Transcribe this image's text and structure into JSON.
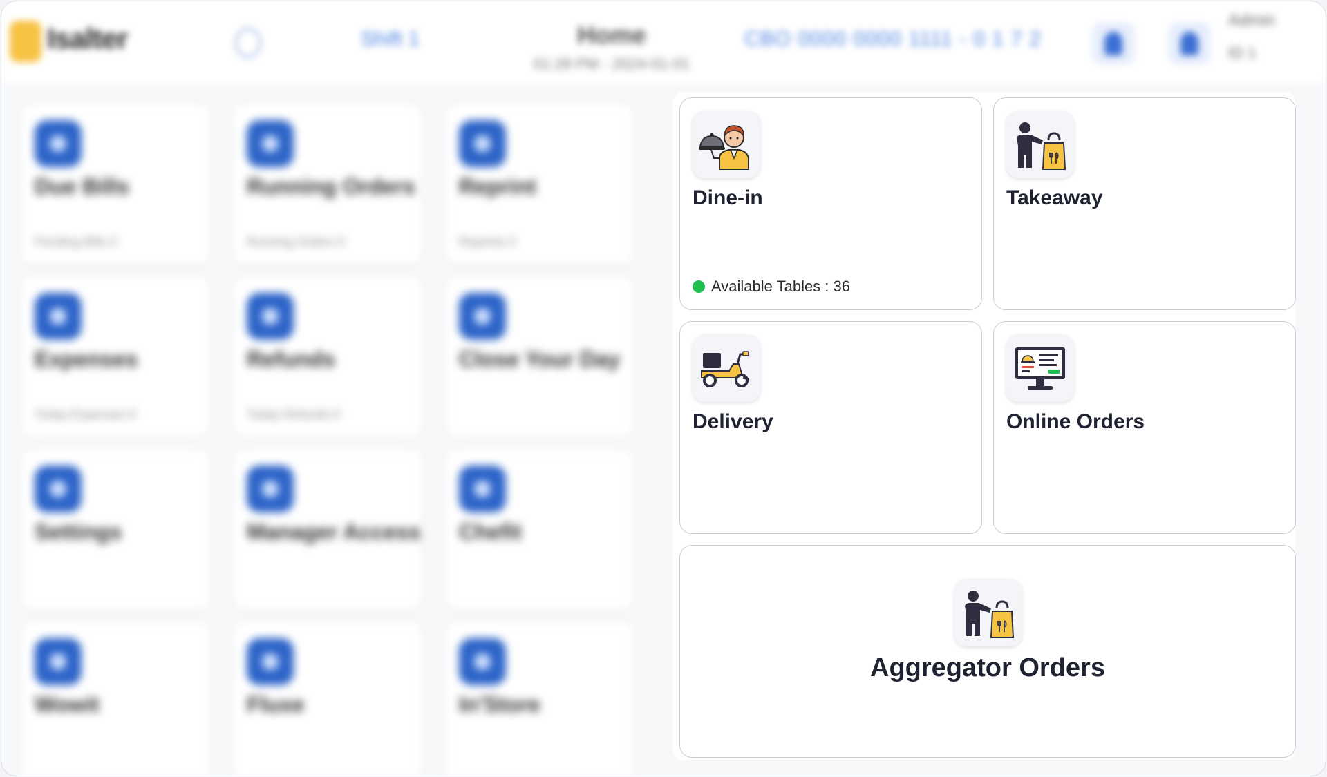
{
  "header": {
    "logo_text": "Isalter",
    "shift_label": "Shift 1",
    "title": "Home",
    "datetime": "01:28 PM - 2024-01-01",
    "terminal_code": "CBO 0000 0000 1111 - 0 1 7 2",
    "user_name": "Admin",
    "user_role": "ID 1"
  },
  "left_tiles": [
    {
      "label": "Due Bills",
      "sub": "Pending Bills 0"
    },
    {
      "label": "Running Orders",
      "sub": "Running Orders 0"
    },
    {
      "label": "Reprint",
      "sub": "Reprints 0"
    },
    {
      "label": "Expenses",
      "sub": "Today Expenses 0"
    },
    {
      "label": "Refunds",
      "sub": "Today Refunds 0"
    },
    {
      "label": "Close Your Day",
      "sub": ""
    },
    {
      "label": "Settings",
      "sub": ""
    },
    {
      "label": "Manager Access",
      "sub": ""
    },
    {
      "label": "Chefit",
      "sub": ""
    },
    {
      "label": "Wowit",
      "sub": ""
    },
    {
      "label": "Fluxe",
      "sub": ""
    },
    {
      "label": "In'Store",
      "sub": ""
    }
  ],
  "order_types": {
    "dine_in": {
      "label": "Dine-in",
      "status": "Available Tables : 36",
      "icon": "waiter-icon"
    },
    "takeaway": {
      "label": "Takeaway",
      "icon": "takeaway-bag-icon"
    },
    "delivery": {
      "label": "Delivery",
      "icon": "delivery-scooter-icon"
    },
    "online": {
      "label": "Online Orders",
      "icon": "online-orders-monitor-icon"
    },
    "aggregator": {
      "label": "Aggregator Orders",
      "icon": "takeaway-bag-icon"
    }
  },
  "colors": {
    "accent_blue": "#2d64c8",
    "icon_yellow": "#f6c343",
    "available_green": "#1fbf4f",
    "card_border": "#c9ccd4"
  }
}
